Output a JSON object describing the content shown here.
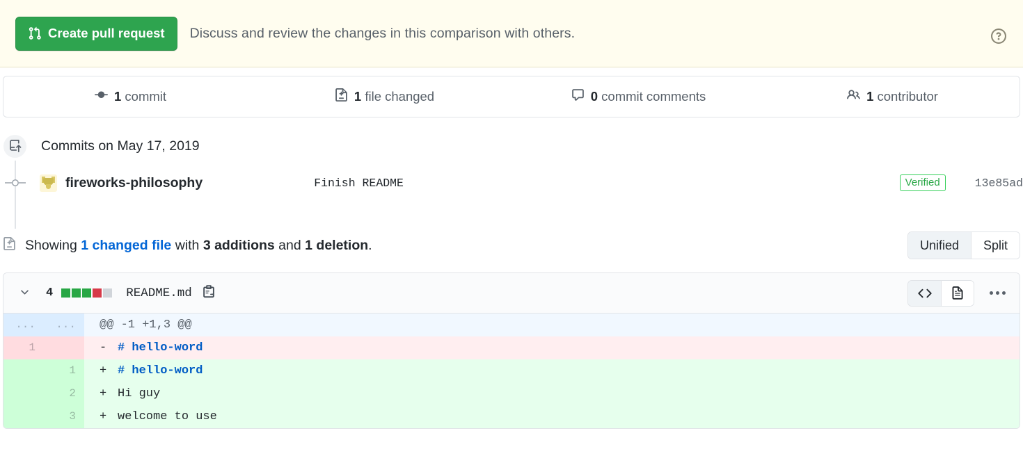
{
  "banner": {
    "button_label": "Create pull request",
    "button_icon": "git-pull-request-icon",
    "description": "Discuss and review the changes in this comparison with others.",
    "help_icon": "question-mark-icon",
    "background_color": "#fffdef",
    "button_color": "#2ea44f"
  },
  "stats": [
    {
      "icon": "git-commit-icon",
      "count": "1",
      "label": "commit"
    },
    {
      "icon": "file-diff-icon",
      "count": "1",
      "label": "file changed"
    },
    {
      "icon": "comment-icon",
      "count": "0",
      "label": "commit comments"
    },
    {
      "icon": "people-icon",
      "count": "1",
      "label": "contributor"
    }
  ],
  "commits": {
    "group_icon": "repo-push-icon",
    "group_title": "Commits on May 17, 2019",
    "rows": [
      {
        "author": "fireworks-philosophy",
        "message": "Finish README",
        "verified_label": "Verified",
        "sha": "13e85ad"
      }
    ]
  },
  "showing": {
    "icon": "file-diff-icon",
    "prefix": "Showing",
    "changed_file_link": "1 changed file",
    "with": "with",
    "additions": "3 additions",
    "and": "and",
    "deletions": "1 deletion",
    "period": ".",
    "view_modes": [
      {
        "label": "Unified",
        "selected": true
      },
      {
        "label": "Split",
        "selected": false
      }
    ]
  },
  "file": {
    "chevron_icon": "chevron-down-icon",
    "change_count": "4",
    "diffstat_blocks": [
      "add",
      "add",
      "add",
      "del",
      "none"
    ],
    "name": "README.md",
    "copy_icon": "copy-path-icon",
    "view_buttons": [
      {
        "icon": "code-icon",
        "selected": true
      },
      {
        "icon": "file-icon",
        "selected": false
      }
    ],
    "menu_icon": "kebab-horizontal-icon"
  },
  "diff": {
    "rows": [
      {
        "type": "hunk",
        "old_ln": "...",
        "new_ln": "...",
        "sign": "",
        "text": "@@ -1 +1,3 @@"
      },
      {
        "type": "del",
        "old_ln": "1",
        "new_ln": "",
        "sign": "-",
        "text": "# hello-word",
        "highlight": "markdown-heading"
      },
      {
        "type": "add",
        "old_ln": "",
        "new_ln": "1",
        "sign": "+",
        "text": "# hello-word",
        "highlight": "markdown-heading"
      },
      {
        "type": "add",
        "old_ln": "",
        "new_ln": "2",
        "sign": "+",
        "text": "Hi guy",
        "highlight": ""
      },
      {
        "type": "add",
        "old_ln": "",
        "new_ln": "3",
        "sign": "+",
        "text": "welcome to use",
        "highlight": ""
      }
    ]
  }
}
